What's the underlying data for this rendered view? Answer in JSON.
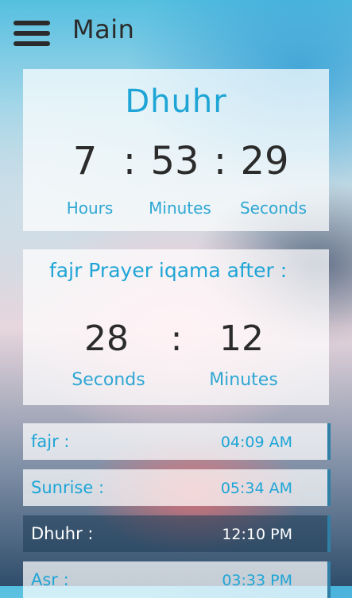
{
  "header": {
    "title": "Main"
  },
  "next_prayer": {
    "name": "Dhuhr",
    "hours": "7",
    "minutes": "53",
    "seconds": "29",
    "separator": ":",
    "labels": {
      "hours": "Hours",
      "minutes": "Minutes",
      "seconds": "Seconds"
    }
  },
  "iqama": {
    "title": "fajr Prayer iqama after :",
    "left_value": "28",
    "right_value": "12",
    "separator": ":",
    "left_label": "Seconds",
    "right_label": "Minutes"
  },
  "prayers": [
    {
      "name": "fajr :",
      "time": "04:09 AM"
    },
    {
      "name": "Sunrise :",
      "time": "05:34 AM"
    },
    {
      "name": "Dhuhr :",
      "time": "12:10 PM"
    },
    {
      "name": "Asr :",
      "time": "03:33 PM"
    }
  ],
  "colors": {
    "accent": "#1ea5d6",
    "text_dark": "#2b2b2b",
    "active_row": "#1e3c55"
  }
}
